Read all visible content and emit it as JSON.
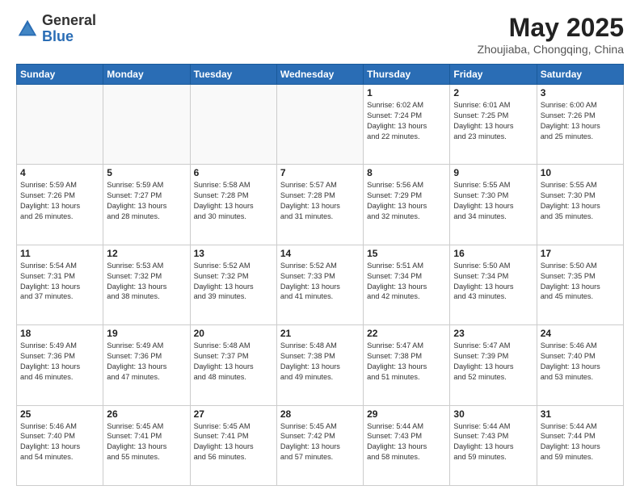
{
  "header": {
    "logo_general": "General",
    "logo_blue": "Blue",
    "month_year": "May 2025",
    "location": "Zhoujiaba, Chongqing, China"
  },
  "weekdays": [
    "Sunday",
    "Monday",
    "Tuesday",
    "Wednesday",
    "Thursday",
    "Friday",
    "Saturday"
  ],
  "weeks": [
    [
      {
        "day": "",
        "info": ""
      },
      {
        "day": "",
        "info": ""
      },
      {
        "day": "",
        "info": ""
      },
      {
        "day": "",
        "info": ""
      },
      {
        "day": "1",
        "info": "Sunrise: 6:02 AM\nSunset: 7:24 PM\nDaylight: 13 hours\nand 22 minutes."
      },
      {
        "day": "2",
        "info": "Sunrise: 6:01 AM\nSunset: 7:25 PM\nDaylight: 13 hours\nand 23 minutes."
      },
      {
        "day": "3",
        "info": "Sunrise: 6:00 AM\nSunset: 7:26 PM\nDaylight: 13 hours\nand 25 minutes."
      }
    ],
    [
      {
        "day": "4",
        "info": "Sunrise: 5:59 AM\nSunset: 7:26 PM\nDaylight: 13 hours\nand 26 minutes."
      },
      {
        "day": "5",
        "info": "Sunrise: 5:59 AM\nSunset: 7:27 PM\nDaylight: 13 hours\nand 28 minutes."
      },
      {
        "day": "6",
        "info": "Sunrise: 5:58 AM\nSunset: 7:28 PM\nDaylight: 13 hours\nand 30 minutes."
      },
      {
        "day": "7",
        "info": "Sunrise: 5:57 AM\nSunset: 7:28 PM\nDaylight: 13 hours\nand 31 minutes."
      },
      {
        "day": "8",
        "info": "Sunrise: 5:56 AM\nSunset: 7:29 PM\nDaylight: 13 hours\nand 32 minutes."
      },
      {
        "day": "9",
        "info": "Sunrise: 5:55 AM\nSunset: 7:30 PM\nDaylight: 13 hours\nand 34 minutes."
      },
      {
        "day": "10",
        "info": "Sunrise: 5:55 AM\nSunset: 7:30 PM\nDaylight: 13 hours\nand 35 minutes."
      }
    ],
    [
      {
        "day": "11",
        "info": "Sunrise: 5:54 AM\nSunset: 7:31 PM\nDaylight: 13 hours\nand 37 minutes."
      },
      {
        "day": "12",
        "info": "Sunrise: 5:53 AM\nSunset: 7:32 PM\nDaylight: 13 hours\nand 38 minutes."
      },
      {
        "day": "13",
        "info": "Sunrise: 5:52 AM\nSunset: 7:32 PM\nDaylight: 13 hours\nand 39 minutes."
      },
      {
        "day": "14",
        "info": "Sunrise: 5:52 AM\nSunset: 7:33 PM\nDaylight: 13 hours\nand 41 minutes."
      },
      {
        "day": "15",
        "info": "Sunrise: 5:51 AM\nSunset: 7:34 PM\nDaylight: 13 hours\nand 42 minutes."
      },
      {
        "day": "16",
        "info": "Sunrise: 5:50 AM\nSunset: 7:34 PM\nDaylight: 13 hours\nand 43 minutes."
      },
      {
        "day": "17",
        "info": "Sunrise: 5:50 AM\nSunset: 7:35 PM\nDaylight: 13 hours\nand 45 minutes."
      }
    ],
    [
      {
        "day": "18",
        "info": "Sunrise: 5:49 AM\nSunset: 7:36 PM\nDaylight: 13 hours\nand 46 minutes."
      },
      {
        "day": "19",
        "info": "Sunrise: 5:49 AM\nSunset: 7:36 PM\nDaylight: 13 hours\nand 47 minutes."
      },
      {
        "day": "20",
        "info": "Sunrise: 5:48 AM\nSunset: 7:37 PM\nDaylight: 13 hours\nand 48 minutes."
      },
      {
        "day": "21",
        "info": "Sunrise: 5:48 AM\nSunset: 7:38 PM\nDaylight: 13 hours\nand 49 minutes."
      },
      {
        "day": "22",
        "info": "Sunrise: 5:47 AM\nSunset: 7:38 PM\nDaylight: 13 hours\nand 51 minutes."
      },
      {
        "day": "23",
        "info": "Sunrise: 5:47 AM\nSunset: 7:39 PM\nDaylight: 13 hours\nand 52 minutes."
      },
      {
        "day": "24",
        "info": "Sunrise: 5:46 AM\nSunset: 7:40 PM\nDaylight: 13 hours\nand 53 minutes."
      }
    ],
    [
      {
        "day": "25",
        "info": "Sunrise: 5:46 AM\nSunset: 7:40 PM\nDaylight: 13 hours\nand 54 minutes."
      },
      {
        "day": "26",
        "info": "Sunrise: 5:45 AM\nSunset: 7:41 PM\nDaylight: 13 hours\nand 55 minutes."
      },
      {
        "day": "27",
        "info": "Sunrise: 5:45 AM\nSunset: 7:41 PM\nDaylight: 13 hours\nand 56 minutes."
      },
      {
        "day": "28",
        "info": "Sunrise: 5:45 AM\nSunset: 7:42 PM\nDaylight: 13 hours\nand 57 minutes."
      },
      {
        "day": "29",
        "info": "Sunrise: 5:44 AM\nSunset: 7:43 PM\nDaylight: 13 hours\nand 58 minutes."
      },
      {
        "day": "30",
        "info": "Sunrise: 5:44 AM\nSunset: 7:43 PM\nDaylight: 13 hours\nand 59 minutes."
      },
      {
        "day": "31",
        "info": "Sunrise: 5:44 AM\nSunset: 7:44 PM\nDaylight: 13 hours\nand 59 minutes."
      }
    ]
  ]
}
